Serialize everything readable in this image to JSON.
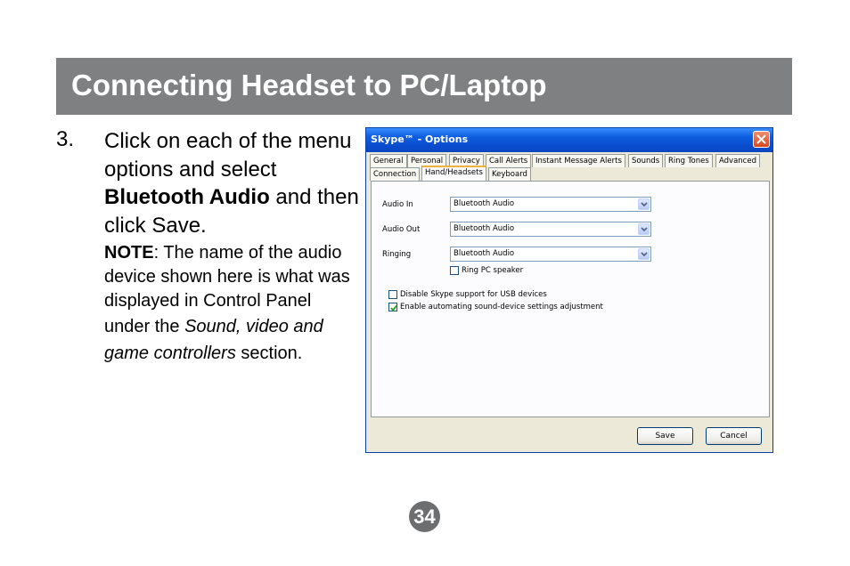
{
  "header": {
    "title": "Connecting Headset to PC/Laptop"
  },
  "instruction": {
    "number": "3.",
    "text_part1": "Click on each of the menu options and select ",
    "text_bold": "Bluetooth Audio",
    "text_part2": " and then click Save.",
    "note_label": "NOTE",
    "note_text1": ": The name of the audio device shown here is what was displayed in Control Panel under the ",
    "note_italic": "Sound, video and game controllers",
    "note_text2": " section."
  },
  "window": {
    "title": "Skype™ - Options",
    "tabs_row1": [
      "General",
      "Personal",
      "Privacy",
      "Call Alerts",
      "Instant Message Alerts",
      "Sounds",
      "Ring Tones",
      "Advanced"
    ],
    "tabs_row2": [
      "Connection",
      "Hand/Headsets",
      "Keyboard"
    ],
    "active_tab": "Hand/Headsets",
    "fields": [
      {
        "label": "Audio In",
        "value": "Bluetooth Audio"
      },
      {
        "label": "Audio Out",
        "value": "Bluetooth Audio"
      },
      {
        "label": "Ringing",
        "value": "Bluetooth Audio"
      }
    ],
    "ring_pc_speaker": {
      "label": "Ring PC speaker",
      "checked": false
    },
    "disable_usb": {
      "label": "Disable Skype support for USB devices",
      "checked": false
    },
    "enable_auto": {
      "label": "Enable automating sound-device settings adjustment",
      "checked": true
    },
    "save_label": "Save",
    "cancel_label": "Cancel"
  },
  "page_number": "34",
  "colors": {
    "header_bg": "#7f8082",
    "titlebar": "#0a4ed0",
    "badge_bg": "#6d6e70"
  }
}
